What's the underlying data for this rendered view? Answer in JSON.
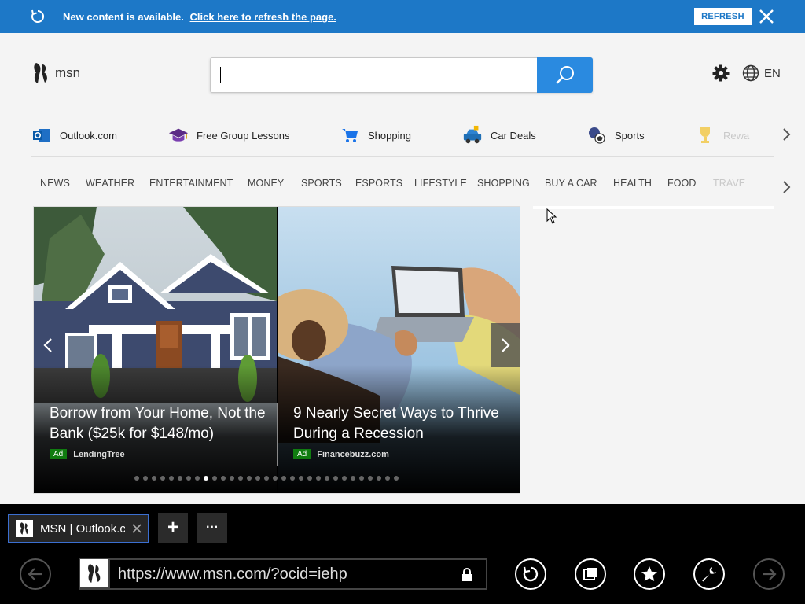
{
  "notification": {
    "message": "New content is available.",
    "link_text": "Click here to refresh the page.",
    "refresh_button": "REFRESH"
  },
  "header": {
    "logo_text": "msn",
    "search_placeholder": "",
    "language": "EN"
  },
  "quick_links": [
    {
      "label": "Outlook.com",
      "icon": "outlook-icon"
    },
    {
      "label": "Free Group Lessons",
      "icon": "graduation-cap-icon"
    },
    {
      "label": "Shopping",
      "icon": "shopping-cart-icon"
    },
    {
      "label": "Car Deals",
      "icon": "car-icon"
    },
    {
      "label": "Sports",
      "icon": "sports-ball-icon"
    },
    {
      "label": "Rewa",
      "icon": "rewards-icon"
    }
  ],
  "categories": [
    "NEWS",
    "WEATHER",
    "ENTERTAINMENT",
    "MONEY",
    "SPORTS",
    "ESPORTS",
    "LIFESTYLE",
    "SHOPPING",
    "BUY A CAR",
    "HEALTH",
    "FOOD",
    "TRAVE"
  ],
  "carousel": {
    "slides": [
      {
        "caption": "Borrow from Your Home, Not the Bank ($25k for $148/mo)",
        "badge": "Ad",
        "source": "LendingTree"
      },
      {
        "caption": "9 Nearly Secret Ways to Thrive During a Recession",
        "badge": "Ad",
        "source": "Financebuzz.com"
      }
    ],
    "total_dots": 31,
    "active_dot": 8
  },
  "browser": {
    "tab_title": "MSN | Outlook.com",
    "url": "https://www.msn.com/?ocid=iehp",
    "new_tab_label": "+",
    "more_label": "···"
  },
  "colors": {
    "notification_bar": "#1d78c7",
    "search_button": "#2a8ae0",
    "ad_badge": "#107c10",
    "tab_border": "#3b6fd1"
  }
}
